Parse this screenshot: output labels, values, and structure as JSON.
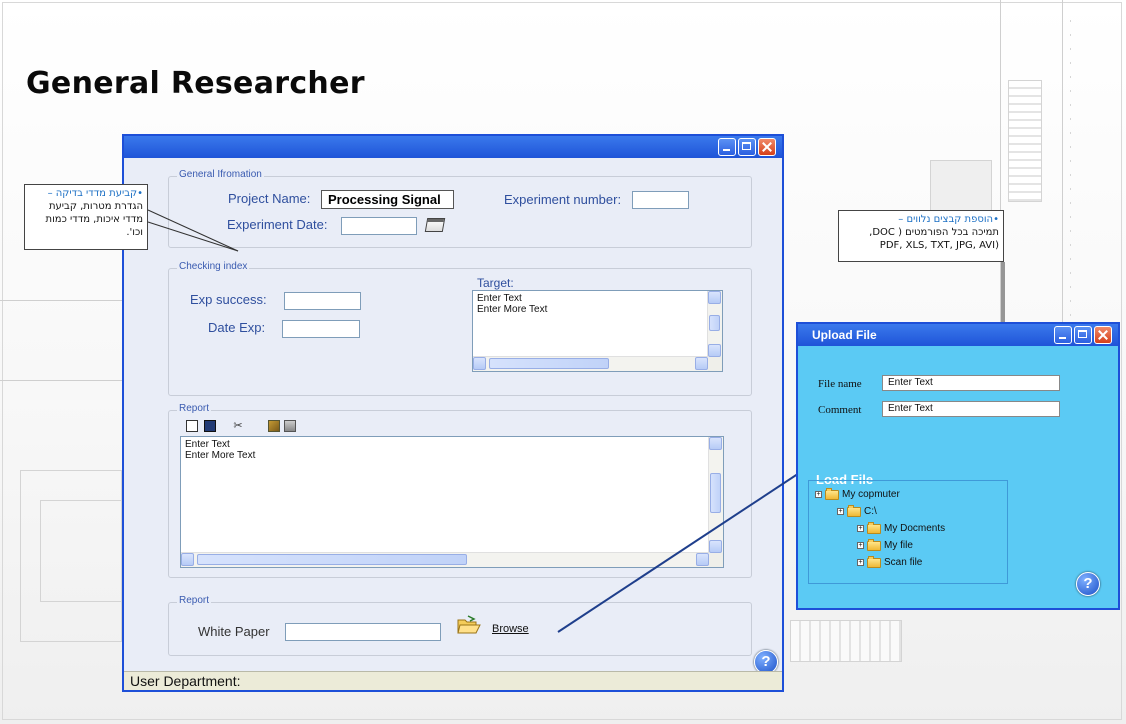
{
  "slide": {
    "title": "General Researcher"
  },
  "main_window": {
    "general_info": {
      "group_label": "General Ifromation",
      "project_name_label": "Project Name:",
      "project_name_value": "Processing Signal",
      "experiment_number_label": "Experiment number:",
      "experiment_number_value": "",
      "experiment_date_label": "Experiment Date:",
      "experiment_date_value": ""
    },
    "checking_index": {
      "group_label": "Checking index",
      "exp_success_label": "Exp success:",
      "exp_success_value": "",
      "date_exp_label": "Date Exp:",
      "date_exp_value": "",
      "target_label": "Target:",
      "target_lines": [
        "Enter Text",
        "Enter More Text"
      ]
    },
    "report": {
      "group_label": "Report",
      "lines": [
        "Enter Text",
        "Enter More Text"
      ],
      "toolbar": [
        "new-document-icon",
        "save-icon",
        "cut-icon",
        "paste-icon",
        "print-icon"
      ]
    },
    "report_file": {
      "group_label": "Report",
      "white_paper_label": "White Paper",
      "white_paper_value": "",
      "browse_label": "Browse"
    },
    "help_label": "?",
    "status_label": "User Department:"
  },
  "callout_left": {
    "lines": [
      "•קביעת מדדי בדיקה –",
      "הגדרת מטרות, קביעת",
      "מדדי איכות, מדדי כמות",
      "וכו'."
    ],
    "highlight": "•קביעת מדדי בדיקה"
  },
  "callout_right": {
    "lines": [
      "•הוספת קבצים נלווים –",
      "תמיכה בכל הפורמטים ( DOC,",
      "(PDF, XLS, TXT, JPG, AVI"
    ],
    "highlight": "•הוספת קבצים נלווים"
  },
  "upload_window": {
    "title": "Upload File",
    "file_name_label": "File name",
    "file_name_value": "Enter Text",
    "comment_label": "Comment",
    "comment_value": "Enter Text",
    "load_file_label": "Load File",
    "tree": [
      {
        "label": "My copmuter",
        "level": 0
      },
      {
        "label": "C:\\",
        "level": 1
      },
      {
        "label": "My Docments",
        "level": 2
      },
      {
        "label": "My file",
        "level": 2
      },
      {
        "label": "Scan file",
        "level": 2
      }
    ],
    "help_label": "?"
  },
  "colors": {
    "window_border": "#1d4fd8",
    "upload_bg": "#5bcaf4",
    "label_blue": "#2f4f9e",
    "callout_highlight": "#1b6fc4"
  }
}
